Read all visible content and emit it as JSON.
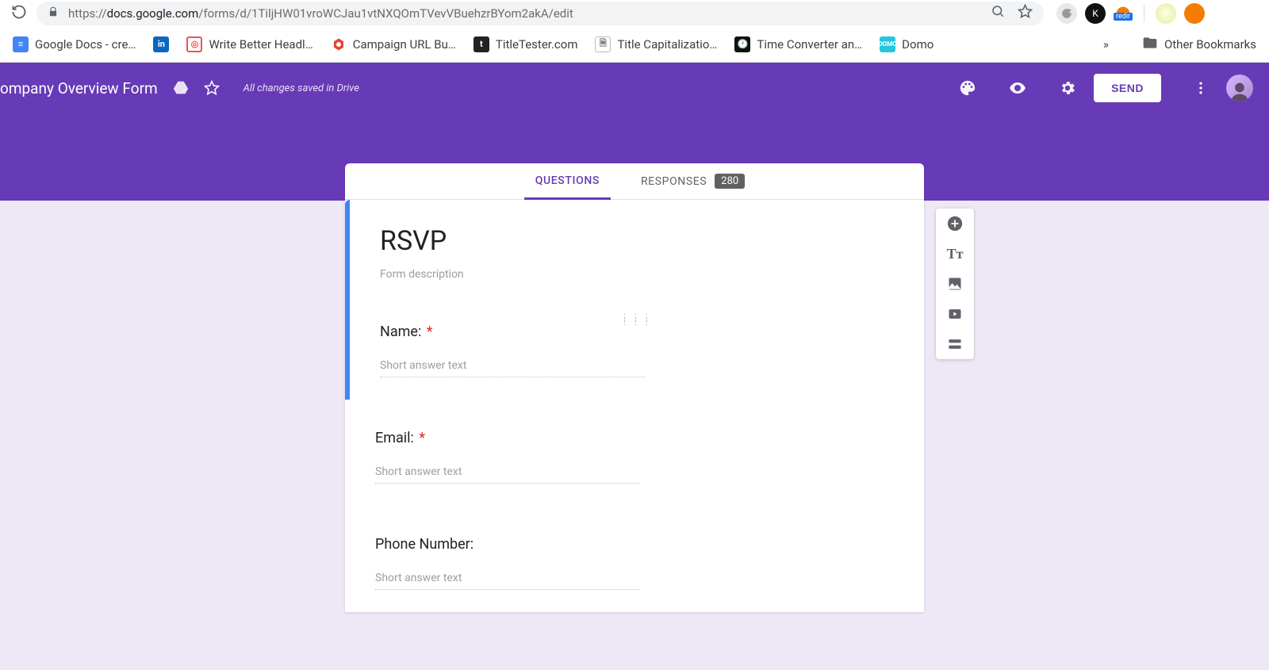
{
  "browser": {
    "url_prefix": "https://",
    "url_domain": "docs.google.com",
    "url_path": "/forms/d/1TiljHW01vroWCJau1vtNXQOmTVevVBuehzrBYom2akA/edit"
  },
  "bookmarks": {
    "b1": "Google Docs - cre…",
    "b2": "Write Better Headl…",
    "b3": "Campaign URL Bu…",
    "b4": "TitleTester.com",
    "b5": "Title Capitalizatio…",
    "b6": "Time Converter an…",
    "b7": "Domo",
    "overflow": "»",
    "other": "Other Bookmarks"
  },
  "header": {
    "doc_title": "ompany Overview Form",
    "saved": "All changes saved in Drive",
    "send": "SEND"
  },
  "tabs": {
    "questions": "QUESTIONS",
    "responses": "RESPONSES",
    "response_count": "280"
  },
  "form": {
    "title": "RSVP",
    "description_placeholder": "Form description",
    "answer_placeholder": "Short answer text",
    "q1": "Name:",
    "q2": "Email:",
    "q3": "Phone Number:"
  }
}
